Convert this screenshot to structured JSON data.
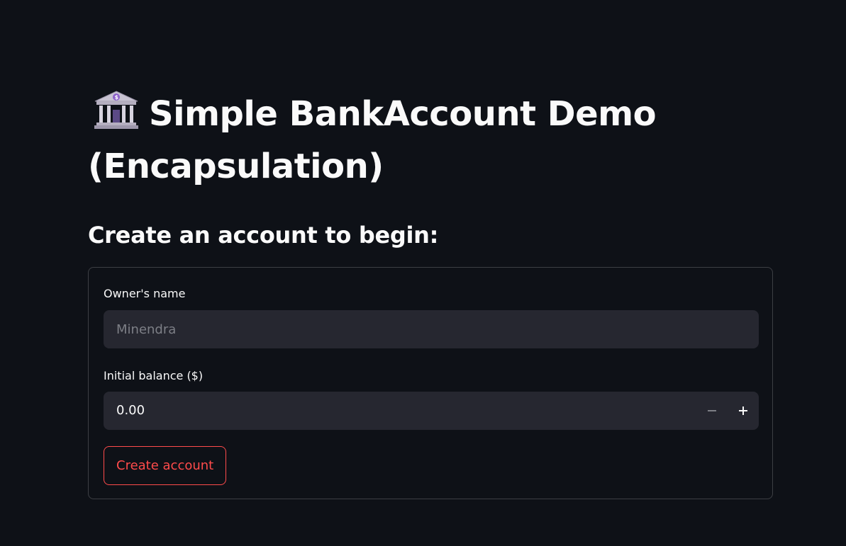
{
  "page": {
    "title": "Simple BankAccount Demo (Encapsulation)",
    "title_icon": "bank-building-icon",
    "subtitle": "Create an account to begin:"
  },
  "form": {
    "owner_name_label": "Owner's name",
    "owner_name_placeholder": "Minendra",
    "owner_name_value": "",
    "initial_balance_label": "Initial balance ($)",
    "initial_balance_value": "0.00",
    "decrement_icon": "minus-icon",
    "increment_icon": "plus-icon",
    "submit_label": "Create account"
  },
  "colors": {
    "background": "#0e1117",
    "text": "#fafafa",
    "input_background": "#262730",
    "primary_accent": "#ff4b4b"
  }
}
